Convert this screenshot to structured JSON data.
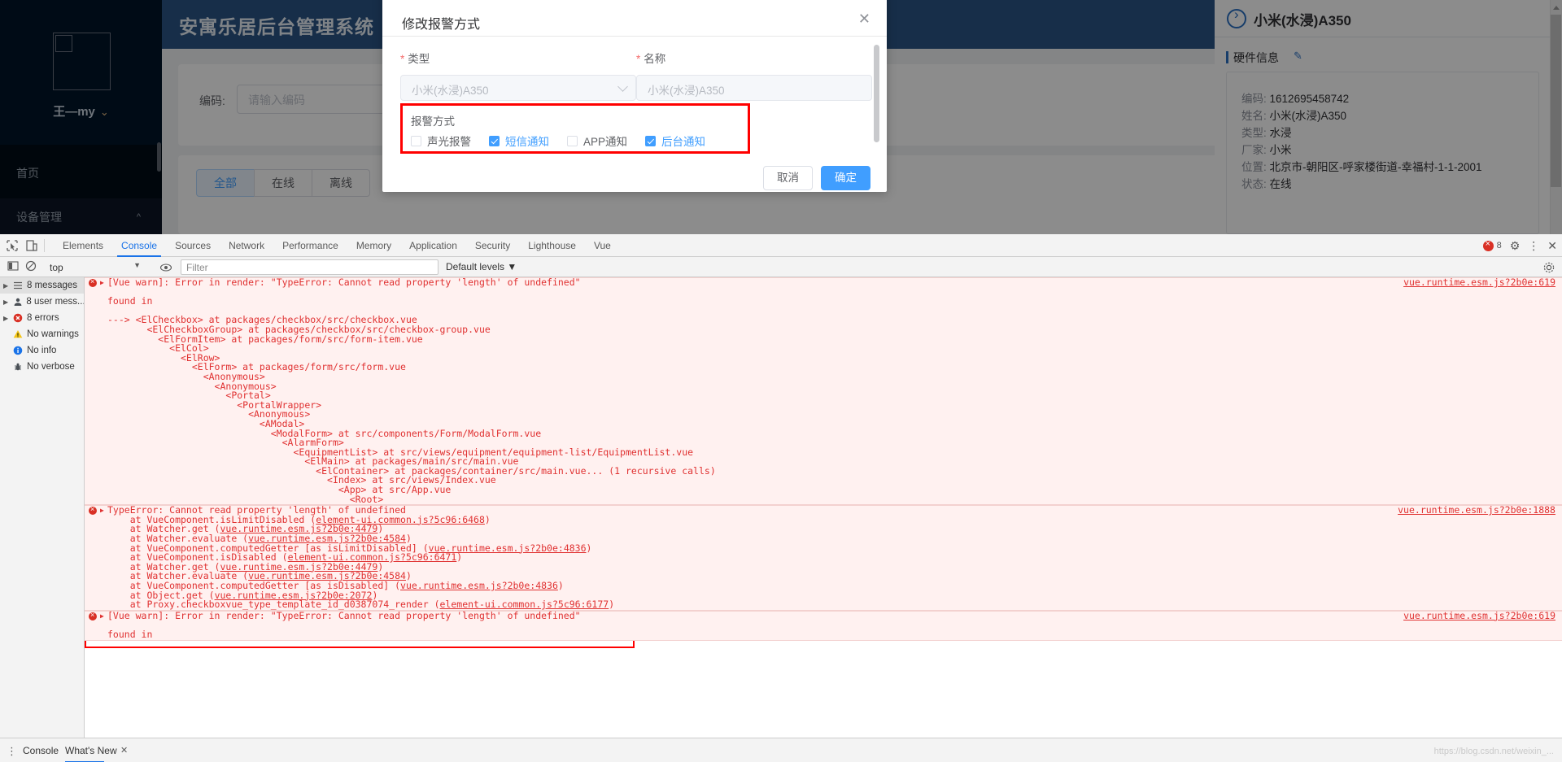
{
  "app": {
    "sidebar": {
      "user_name": "王—my",
      "caret": "⌄",
      "items": [
        {
          "label": "首页",
          "arrow": ""
        },
        {
          "label": "设备管理",
          "arrow": "^"
        }
      ]
    },
    "header": {
      "title": "安寓乐居后台管理系统"
    },
    "search": {
      "label": "编码:",
      "placeholder": "请输入编码"
    },
    "filter_buttons": [
      {
        "label": "全部",
        "active": true
      },
      {
        "label": "在线",
        "active": false
      },
      {
        "label": "离线",
        "active": false
      }
    ],
    "drawer": {
      "title": "小米(水浸)A350",
      "section_label": "硬件信息",
      "edit_icon": "pencil-icon",
      "rows": [
        {
          "key": "编码:",
          "value": "1612695458742"
        },
        {
          "key": "姓名:",
          "value": "小米(水浸)A350"
        },
        {
          "key": "类型:",
          "value": "水浸"
        },
        {
          "key": "厂家:",
          "value": "小米"
        },
        {
          "key": "位置:",
          "value": "北京市-朝阳区-呼家楼街道-幸福村-1-1-2001"
        },
        {
          "key": "状态:",
          "value": "在线"
        }
      ]
    }
  },
  "modal": {
    "title": "修改报警方式",
    "close_icon": "close-icon",
    "fields": [
      {
        "required_mark": "*",
        "label": "类型",
        "value": "小米(水浸)A350",
        "type": "select"
      },
      {
        "required_mark": "*",
        "label": "名称",
        "value": "小米(水浸)A350",
        "type": "input"
      }
    ],
    "alarm_section": {
      "label": "报警方式",
      "highlight_color": "#ff0000",
      "options": [
        {
          "label": "声光报警",
          "checked": false
        },
        {
          "label": "短信通知",
          "checked": true
        },
        {
          "label": "APP通知",
          "checked": false
        },
        {
          "label": "后台通知",
          "checked": true
        }
      ]
    },
    "footer": {
      "cancel_label": "取消",
      "confirm_label": "确定",
      "primary_color": "#409eff"
    }
  },
  "devtools": {
    "tabs": [
      {
        "label": "Elements",
        "selected": false
      },
      {
        "label": "Console",
        "selected": true
      },
      {
        "label": "Sources",
        "selected": false
      },
      {
        "label": "Network",
        "selected": false
      },
      {
        "label": "Performance",
        "selected": false
      },
      {
        "label": "Memory",
        "selected": false
      },
      {
        "label": "Application",
        "selected": false
      },
      {
        "label": "Security",
        "selected": false
      },
      {
        "label": "Lighthouse",
        "selected": false
      },
      {
        "label": "Vue",
        "selected": false
      }
    ],
    "error_badge": {
      "count": "8",
      "color": "#d93025"
    },
    "toolbar": {
      "context": "top",
      "filter_placeholder": "Filter",
      "levels": "Default levels"
    },
    "sidebar_items": [
      {
        "label": "8 messages",
        "icon": "list-icon",
        "expandable": true,
        "selected": true
      },
      {
        "label": "8 user mess...",
        "icon": "user-icon",
        "expandable": true,
        "selected": false
      },
      {
        "label": "8 errors",
        "icon": "error-icon",
        "expandable": true,
        "selected": false
      },
      {
        "label": "No warnings",
        "icon": "warning-icon",
        "expandable": false,
        "selected": false
      },
      {
        "label": "No info",
        "icon": "info-icon",
        "expandable": false,
        "selected": false
      },
      {
        "label": "No verbose",
        "icon": "bug-icon",
        "expandable": false,
        "selected": false
      }
    ],
    "console_groups": [
      {
        "source": "vue.runtime.esm.js?2b0e:619",
        "lines": [
          "[Vue warn]: Error in render: \"TypeError: Cannot read property 'length' of undefined\"",
          "",
          "found in",
          "",
          "---> <ElCheckbox> at packages/checkbox/src/checkbox.vue",
          "       <ElCheckboxGroup> at packages/checkbox/src/checkbox-group.vue",
          "         <ElFormItem> at packages/form/src/form-item.vue",
          "           <ElCol>",
          "             <ElRow>",
          "               <ElForm> at packages/form/src/form.vue",
          "                 <Anonymous>",
          "                   <Anonymous>",
          "                     <Portal>",
          "                       <PortalWrapper>",
          "                         <Anonymous>",
          "                           <AModal>",
          "                             <ModalForm> at src/components/Form/ModalForm.vue",
          "                               <AlarmForm>",
          "                                 <EquipmentList> at src/views/equipment/equipment-list/EquipmentList.vue",
          "                                   <ElMain> at packages/main/src/main.vue",
          "                                     <ElContainer> at packages/container/src/main.vue... (1 recursive calls)",
          "                                       <Index> at src/views/Index.vue",
          "                                         <App> at src/App.vue",
          "                                           <Root>"
        ]
      },
      {
        "source": "vue.runtime.esm.js?2b0e:1888",
        "lines": [
          "TypeError: Cannot read property 'length' of undefined",
          "    at VueComponent.isLimitDisabled (element-ui.common.js?5c96:6468)",
          "    at Watcher.get (vue.runtime.esm.js?2b0e:4479)",
          "    at Watcher.evaluate (vue.runtime.esm.js?2b0e:4584)",
          "    at VueComponent.computedGetter [as isLimitDisabled] (vue.runtime.esm.js?2b0e:4836)",
          "    at VueComponent.isDisabled (element-ui.common.js?5c96:6471)",
          "    at Watcher.get (vue.runtime.esm.js?2b0e:4479)",
          "    at Watcher.evaluate (vue.runtime.esm.js?2b0e:4584)",
          "    at VueComponent.computedGetter [as isDisabled] (vue.runtime.esm.js?2b0e:4836)",
          "    at Object.get (vue.runtime.esm.js?2b0e:2072)",
          "    at Proxy.checkboxvue_type_template_id_d0387074_render (element-ui.common.js?5c96:6177)"
        ]
      },
      {
        "source": "vue.runtime.esm.js?2b0e:619",
        "lines": [
          "[Vue warn]: Error in render: \"TypeError: Cannot read property 'length' of undefined\"",
          "",
          "found in"
        ]
      }
    ],
    "footer": {
      "console_label": "Console",
      "whatsnew_label": "What's New",
      "close_icon": "close-icon"
    },
    "watermark": "https://blog.csdn.net/weixin_..."
  }
}
